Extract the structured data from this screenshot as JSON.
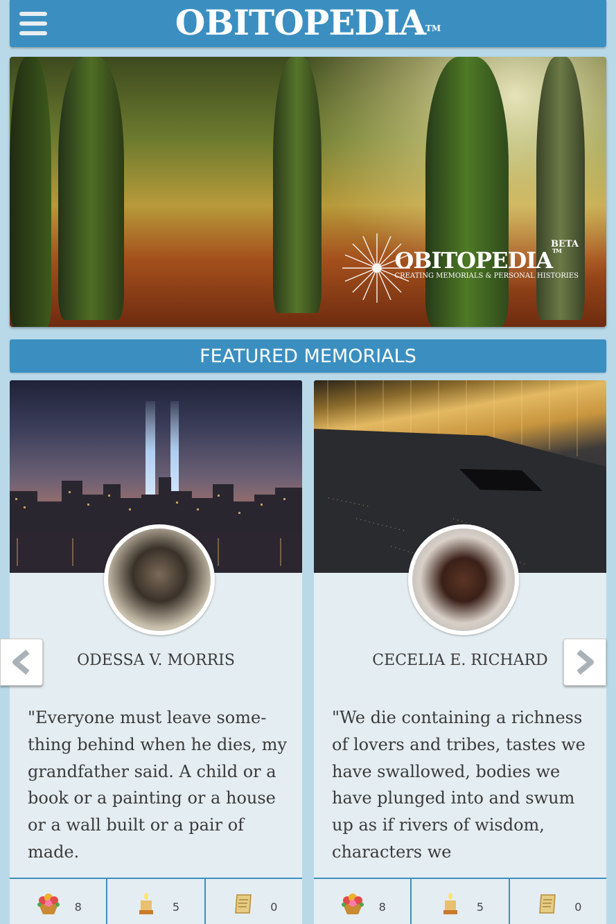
{
  "header": {
    "menu_icon": "hamburger-menu-icon",
    "brand": "OBITOPEDIA",
    "trademark": "TM"
  },
  "hero": {
    "brand": "OBITOPEDIA",
    "trademark": "TM",
    "beta": "BETA",
    "tagline": "CREATING MEMORIALS & PERSONAL HISTORIES",
    "emblem_icon": "dandelion-icon"
  },
  "featured": {
    "title": "FEATURED MEMORIALS",
    "prev_icon": "chevron-left-icon",
    "next_icon": "chevron-right-icon",
    "cards": [
      {
        "name": "ODESSA V. MORRIS",
        "quote": "\"Everyone must leave some-thing behind when he dies, my grandfather said. A child or a book or a painting or a house or a wall built or a pair of made.",
        "stats": {
          "flowers": "8",
          "candles": "5",
          "scrolls": "0"
        }
      },
      {
        "name": "CECELIA E. RICHARD",
        "quote": "\"We die containing a richness of lovers and tribes, tastes we have swallowed, bodies we have plunged into and swum up as if rivers of wisdom, characters we",
        "stats": {
          "flowers": "8",
          "candles": "5",
          "scrolls": "0"
        }
      }
    ]
  },
  "colors": {
    "accent": "#3b8fc0",
    "background": "#b9d9e8",
    "card": "#e4edf1"
  }
}
